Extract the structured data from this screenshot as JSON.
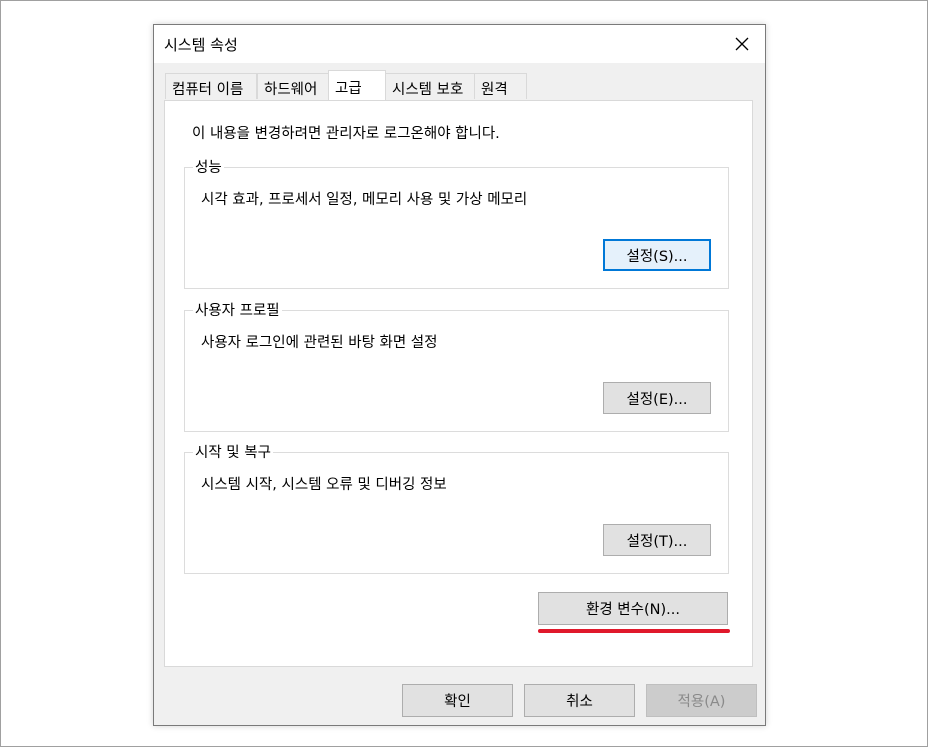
{
  "window": {
    "title": "시스템 속성"
  },
  "tabs": [
    {
      "label": "컴퓨터 이름"
    },
    {
      "label": "하드웨어"
    },
    {
      "label": "고급"
    },
    {
      "label": "시스템 보호"
    },
    {
      "label": "원격"
    }
  ],
  "active_tab": "고급",
  "notice": "이 내용을 변경하려면 관리자로 로그온해야 합니다.",
  "groups": {
    "performance": {
      "label": "성능",
      "description": "시각 효과, 프로세서 일정, 메모리 사용 및 가상 메모리",
      "button": "설정(S)..."
    },
    "user_profiles": {
      "label": "사용자 프로필",
      "description": "사용자 로그인에 관련된 바탕 화면 설정",
      "button": "설정(E)..."
    },
    "startup_recovery": {
      "label": "시작 및 복구",
      "description": "시스템 시작, 시스템 오류 및 디버깅 정보",
      "button": "설정(T)..."
    }
  },
  "env_button": "환경 변수(N)...",
  "footer": {
    "ok": "확인",
    "cancel": "취소",
    "apply": "적용(A)"
  },
  "colors": {
    "highlight_underline": "#e0182b",
    "focus_border": "#0078d7"
  },
  "icons": {
    "close": "close-icon"
  }
}
